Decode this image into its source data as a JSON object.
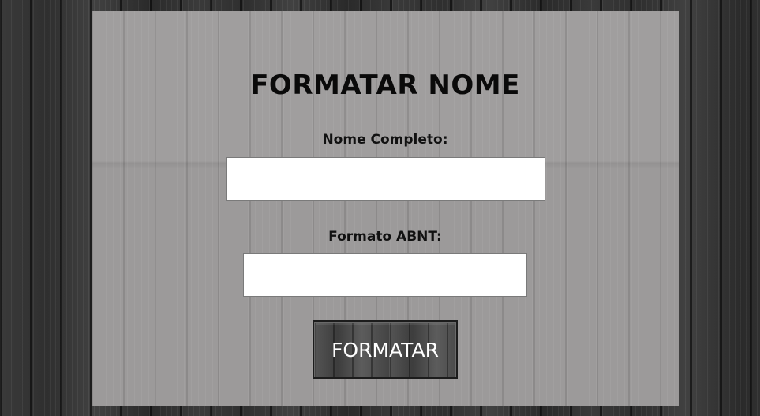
{
  "form": {
    "title": "FORMATAR NOME",
    "nome_label": "Nome Completo:",
    "nome_value": "",
    "abnt_label": "Formato ABNT:",
    "abnt_value": "",
    "button_label": "FORMATAR"
  }
}
